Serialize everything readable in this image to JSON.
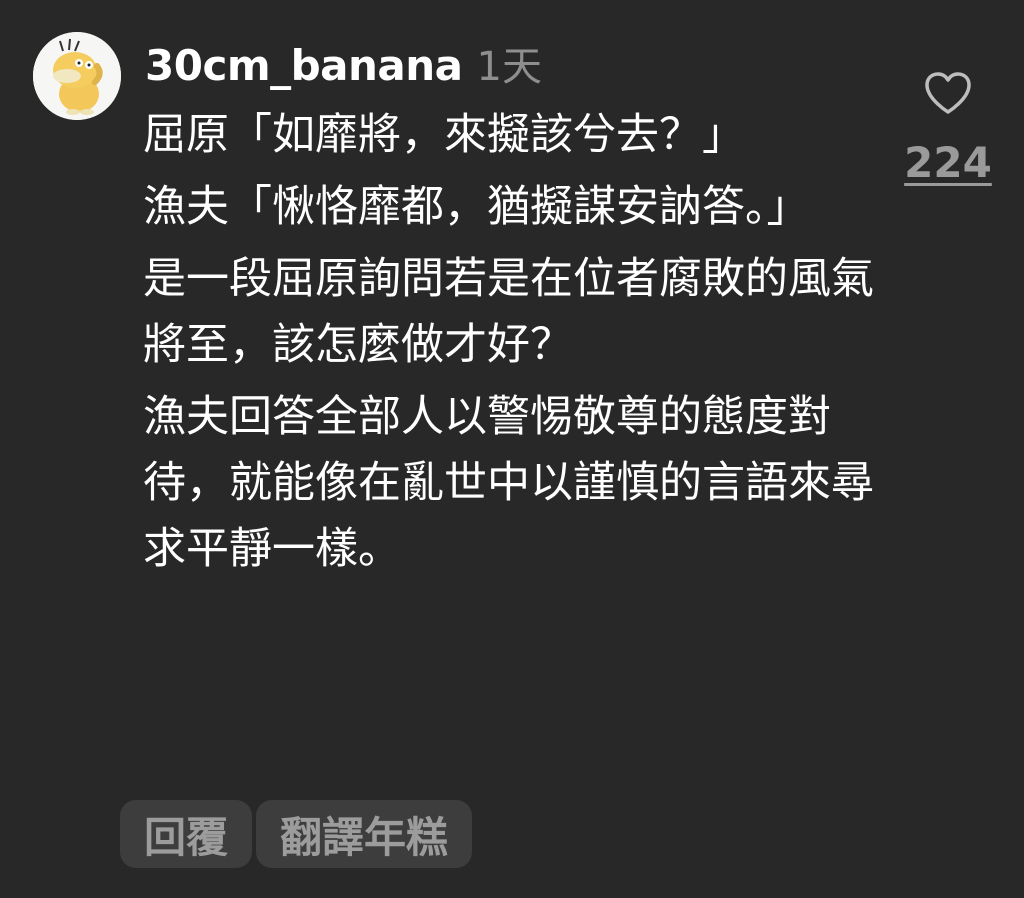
{
  "comment": {
    "username": "30cm_banana",
    "timestamp": "1天",
    "paragraphs": [
      "屈原「如靡將，來擬該兮去？」",
      "漁夫「愀恪靡都，猶擬謀安訥答。」",
      "是一段屈原詢問若是在位者腐敗的風氣將至，該怎麼做才好？",
      "漁夫回答全部人以警惕敬尊的態度對待，就能像在亂世中以謹慎的言語來尋求平靜一樣。"
    ],
    "likes": "224",
    "icons": {
      "avatar": "psyduck-avatar",
      "like": "heart-icon"
    }
  },
  "actions": {
    "reply_label": "回覆",
    "translate_label": "翻譯年糕"
  }
}
